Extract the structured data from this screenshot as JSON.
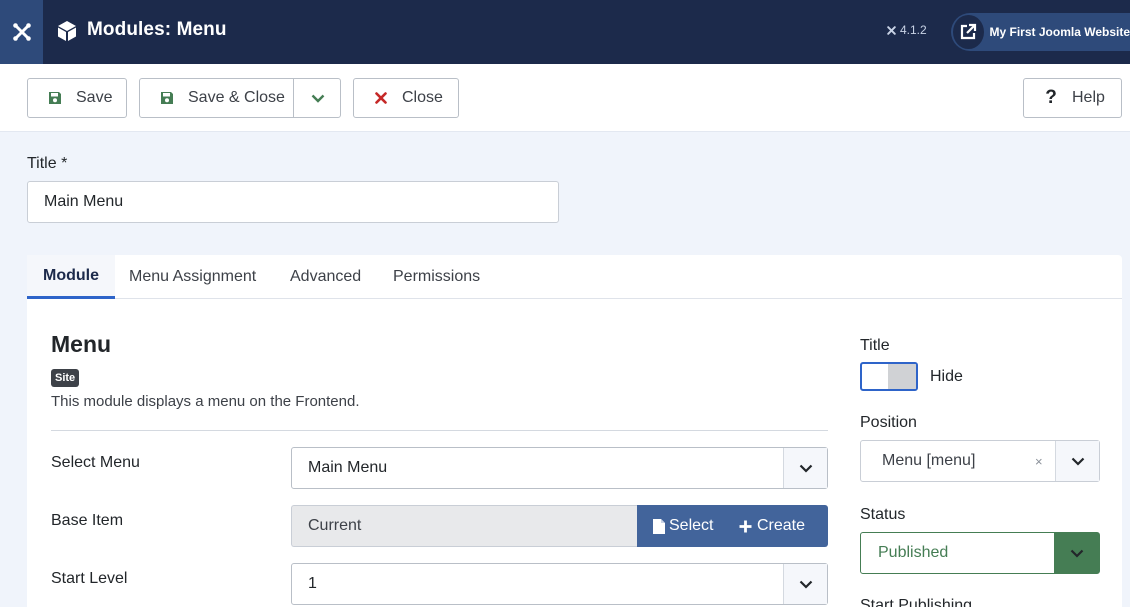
{
  "header": {
    "title": "Modules: Menu",
    "version": "4.1.2",
    "site_name": "My First Joomla Website"
  },
  "toolbar": {
    "save_label": "Save",
    "save_close_label": "Save & Close",
    "close_label": "Close",
    "help_label": "Help"
  },
  "form": {
    "title_label": "Title *",
    "title_value": "Main Menu"
  },
  "tabs": [
    {
      "label": "Module",
      "active": true
    },
    {
      "label": "Menu Assignment",
      "active": false
    },
    {
      "label": "Advanced",
      "active": false
    },
    {
      "label": "Permissions",
      "active": false
    }
  ],
  "module": {
    "heading": "Menu",
    "badge": "Site",
    "description": "This module displays a menu on the Frontend.",
    "select_menu_label": "Select Menu",
    "select_menu_value": "Main Menu",
    "base_item_label": "Base Item",
    "base_item_value": "Current",
    "base_select_label": "Select",
    "base_create_label": "Create",
    "start_level_label": "Start Level",
    "start_level_value": "1"
  },
  "sidebar": {
    "title_label": "Title",
    "title_toggle_label": "Hide",
    "position_label": "Position",
    "position_value": "Menu [menu]",
    "position_clear": "×",
    "status_label": "Status",
    "status_value": "Published",
    "start_publishing_label": "Start Publishing"
  },
  "colors": {
    "header_bg": "#1c2a4b",
    "accent_blue": "#2e64c9",
    "button_blue": "#42649b",
    "save_green": "#457d54",
    "close_red": "#c52827"
  }
}
